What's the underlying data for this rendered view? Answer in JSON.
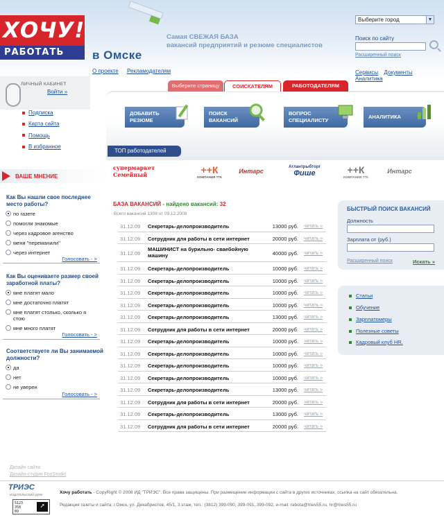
{
  "header": {
    "logo_top": "ХОЧУ!",
    "logo_bottom": "РАБОТАТЬ",
    "city_title": "в Омске",
    "tagline_line1": "Самая СВЕЖАЯ БАЗА",
    "tagline_line2": "вакансий предприятий и резюме специалистов",
    "nav": [
      "О проекте",
      "Рекламодателям"
    ],
    "city_select": "Выберите город",
    "search_label": "Поиск по сайту",
    "search_value": "",
    "advanced_search": "Расширенный поиск",
    "services": [
      "Сервисы",
      "Документы",
      "Аналитика"
    ]
  },
  "cabinet": {
    "title": "ЛИЧНЫЙ КАБИНЕТ",
    "login": "Войти »"
  },
  "left_links": [
    "Подписка",
    "Карта сайта",
    "Помощь",
    "В избранное"
  ],
  "opinion_title": "ВАШЕ МНЕНИЕ",
  "polls": [
    {
      "question": "Как Вы нашли свое последнее место работы?",
      "options": [
        {
          "label": "по газете",
          "selected": true
        },
        {
          "label": "помогли знакомые",
          "selected": false
        },
        {
          "label": "через кадровое агенство",
          "selected": false
        },
        {
          "label": "меня \"переманили\"",
          "selected": false
        },
        {
          "label": "через интернет",
          "selected": false
        }
      ],
      "vote": "Голосовать - >"
    },
    {
      "question": "Как Вы оцениваете размер своей заработной платы?",
      "options": [
        {
          "label": "мне платят мало",
          "selected": true
        },
        {
          "label": "мне достаточно платят",
          "selected": false
        },
        {
          "label": "мне платят столько, сколько я стою",
          "selected": false
        },
        {
          "label": "мне много платят",
          "selected": false
        }
      ],
      "vote": "Голосовать - >"
    },
    {
      "question": "Соответствуете ли Вы занимаемой должности?",
      "options": [
        {
          "label": "да",
          "selected": true
        },
        {
          "label": "нет",
          "selected": false
        },
        {
          "label": "не уверен",
          "selected": false
        }
      ],
      "vote": "Голосовать - >"
    }
  ],
  "design_credit": [
    "Дизайн сайта:",
    "Дизайн-студия FoxStudio"
  ],
  "tabs": {
    "prompt": "Выберите страницу",
    "seekers": "СОИСКАТЕЛЯМ",
    "employers": "РАБОТОДАТЕЛЯМ"
  },
  "big_buttons": [
    {
      "line1": "ДОБАВИТЬ",
      "line2": "РЕЗЮМЕ"
    },
    {
      "line1": "ПОИСК",
      "line2": "ВАКАНСИЙ"
    },
    {
      "line1": "ВОПРОС",
      "line2": "СПЕЦИАЛИСТУ"
    },
    {
      "line1": "АНАЛИТИКА",
      "line2": ""
    }
  ],
  "top_employers": "ТОП работодателей",
  "employers": [
    {
      "name": "супермаркет Семейный",
      "color": "#d6262b"
    },
    {
      "name": "++К",
      "sub": "КОМПАНИЯ ТТК",
      "color": "#e2612b"
    },
    {
      "name": "Интарс",
      "color": "#c8312c"
    },
    {
      "name": "Атлантрыбторг",
      "sub": "Фише",
      "color": "#1f3f88"
    },
    {
      "name": "++К",
      "sub": "КОМПАНИЯ ТТК",
      "color": "#777777"
    },
    {
      "name": "Интарс",
      "color": "#777777"
    }
  ],
  "vacancies_header": {
    "title": "БАЗА ВАКАНСИЙ",
    "found_label": "- найдено вакансий:",
    "found_count": "32",
    "subtitle": "Всего вакансий 1308 от 09.12.2008"
  },
  "vacancies": [
    {
      "date": "31.12.09",
      "title": "Секретарь-делопроизводитель",
      "salary": "13000 руб.",
      "more": "читать »"
    },
    {
      "date": "31.12.09",
      "title": "Сотрудник для работы в сети интернет",
      "salary": "20000 руб.",
      "more": "читать »"
    },
    {
      "date": "31.12.09",
      "title": "МАШИНИСТ на бурильно- сваебойную машину",
      "salary": "40000 руб.",
      "more": "читать »"
    },
    {
      "date": "31.12.09",
      "title": "Секретарь-делопроизводитель",
      "salary": "10000 руб.",
      "more": "читать »"
    },
    {
      "date": "31.12.09",
      "title": "Секретарь-делопроизводитель",
      "salary": "10000 руб.",
      "more": "читать »"
    },
    {
      "date": "31.12.09",
      "title": "Секретарь-делопроизводитель",
      "salary": "10000 руб.",
      "more": "читать »"
    },
    {
      "date": "31.12.09",
      "title": "Секретарь-делопроизводитель",
      "salary": "10000 руб.",
      "more": "читать »"
    },
    {
      "date": "31.12.09",
      "title": "Секретарь-делопроизводитель",
      "salary": "13000 руб.",
      "more": "читать »"
    },
    {
      "date": "31.12.09",
      "title": "Сотрудник для работы в сети интернет",
      "salary": "20000 руб.",
      "more": "читать »"
    },
    {
      "date": "31.12.09",
      "title": "Секретарь-делопроизводитель",
      "salary": "10000 руб.",
      "more": "читать »"
    },
    {
      "date": "31.12.09",
      "title": "Секретарь-делопроизводитель",
      "salary": "10000 руб.",
      "more": "читать »"
    },
    {
      "date": "31.12.09",
      "title": "Секретарь-делопроизводитель",
      "salary": "10000 руб.",
      "more": "читать »"
    },
    {
      "date": "31.12.09",
      "title": "Секретарь-делопроизводитель",
      "salary": "10000 руб.",
      "more": "читать »"
    },
    {
      "date": "31.12.09",
      "title": "Секретарь-делопроизводитель",
      "salary": "13000 руб.",
      "more": "читать »"
    },
    {
      "date": "31.12.09",
      "title": "Сотрудник для работы в сети интернет",
      "salary": "20000 руб.",
      "more": "читать »"
    },
    {
      "date": "31.12.09",
      "title": "Секретарь-делопроизводитель",
      "salary": "13000 руб.",
      "more": "читать »"
    },
    {
      "date": "31.12.09",
      "title": "Сотрудник для работы в сети интернет",
      "salary": "20000 руб.",
      "more": "читать »"
    }
  ],
  "quick_search": {
    "title": "БЫСТРЫЙ ПОИСК ВАКАНСИЙ",
    "position_label": "Должность",
    "position_value": "",
    "salary_label": "Зарплата от (руб.)",
    "salary_value": "",
    "advanced": "Расширенный поиск",
    "go": "Искать »"
  },
  "right_links": [
    "Статьи",
    "Обучение",
    "Зарплатомеры",
    "Полезные советы",
    "Кадровый клуб HR."
  ],
  "footer": {
    "tries_logo": "ТРИЭС",
    "tries_sub": "ИЗДАТЕЛЬСКИЙ ДОМ",
    "counter": [
      "5123",
      "358",
      "89"
    ],
    "brand": "Хочу работать",
    "copyright": "- CopyRight © 2008 ИД \"ТРИЭС\". Все права защищены. При размещении информации с сайта в других источниках, ссылка на сайт обязательна.",
    "address": "Редакция газеты и сайта: г.Омск, ул. Декабристов, 45/1, 3 этаж, тел.: (3812) 399-090, 399-091, 399-092, e-mail: rabota@tries55.ru, hr@tries55.ru"
  },
  "colors": {
    "brand_red": "#d6262b",
    "brand_blue": "#2f3c93",
    "link_blue": "#1a4f9c",
    "accent_green": "#2f8a2f"
  }
}
